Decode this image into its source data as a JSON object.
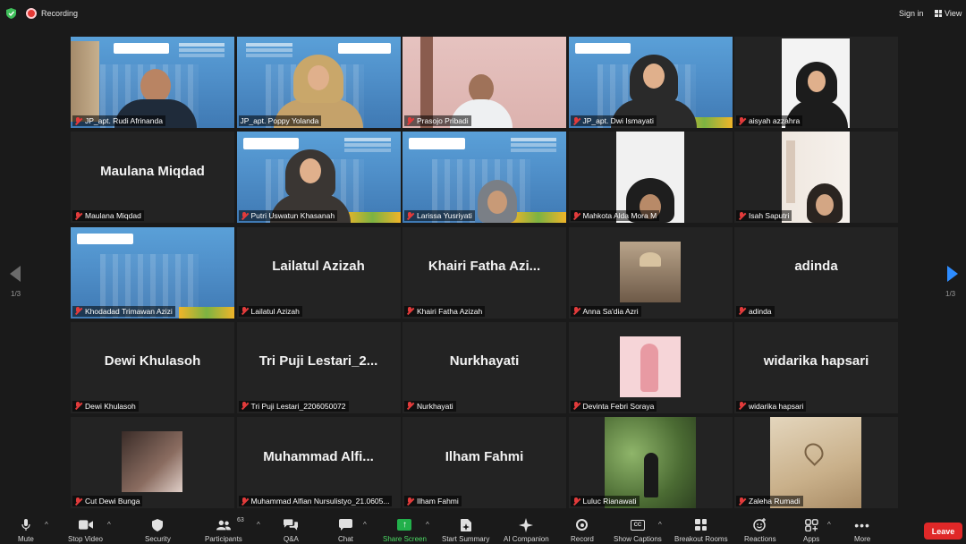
{
  "topbar": {
    "recording_label": "Recording",
    "sign_in_label": "Sign in",
    "view_label": "View"
  },
  "pager": {
    "left": "1/3",
    "right": "1/3"
  },
  "tiles": [
    {
      "name": "JP_apt. Rudi Afrinanda",
      "big": ""
    },
    {
      "name": "JP_apt. Poppy Yolanda",
      "big": ""
    },
    {
      "name": "Prasojo Pribadi",
      "big": ""
    },
    {
      "name": "JP_apt. Dwi Ismayati",
      "big": ""
    },
    {
      "name": "aisyah azzahra",
      "big": ""
    },
    {
      "name": "Maulana Miqdad",
      "big": "Maulana Miqdad"
    },
    {
      "name": "Putri Uswatun Khasanah",
      "big": ""
    },
    {
      "name": "Larissa Yusriyati",
      "big": ""
    },
    {
      "name": "Mahkota Alda Mora M",
      "big": ""
    },
    {
      "name": "Isah Saputri",
      "big": ""
    },
    {
      "name": "Khodadad Trimawan Azizi",
      "big": ""
    },
    {
      "name": "Lailatul Azizah",
      "big": "Lailatul Azizah"
    },
    {
      "name": "Khairi Fatha Azizah",
      "big": "Khairi Fatha Azi..."
    },
    {
      "name": "Anna Sa'dia Azri",
      "big": ""
    },
    {
      "name": "adinda",
      "big": "adinda"
    },
    {
      "name": "Dewi Khulasoh",
      "big": "Dewi Khulasoh"
    },
    {
      "name": "Tri Puji Lestari_2206050072",
      "big": "Tri Puji Lestari_2..."
    },
    {
      "name": "Nurkhayati",
      "big": "Nurkhayati"
    },
    {
      "name": "Devinta Febri Soraya",
      "big": ""
    },
    {
      "name": "widarika hapsari",
      "big": "widarika hapsari"
    },
    {
      "name": "Cut Dewi Bunga",
      "big": ""
    },
    {
      "name": "Muhammad Alfian Nursulistyo_21.0605...",
      "big": "Muhammad Alfi..."
    },
    {
      "name": "Ilham Fahmi",
      "big": "Ilham Fahmi"
    },
    {
      "name": "Luluc Rianawati",
      "big": ""
    },
    {
      "name": "Zaleha Rumadi",
      "big": ""
    }
  ],
  "toolbar": {
    "mute": "Mute",
    "stop_video": "Stop Video",
    "security": "Security",
    "participants": "Participants",
    "participants_count": "63",
    "qa": "Q&A",
    "chat": "Chat",
    "share_screen": "Share Screen",
    "start_summary": "Start Summary",
    "ai_companion": "AI Companion",
    "record": "Record",
    "show_captions": "Show Captions",
    "breakout_rooms": "Breakout Rooms",
    "reactions": "Reactions",
    "apps": "Apps",
    "more": "More",
    "leave": "Leave",
    "cc_glyph": "CC"
  }
}
